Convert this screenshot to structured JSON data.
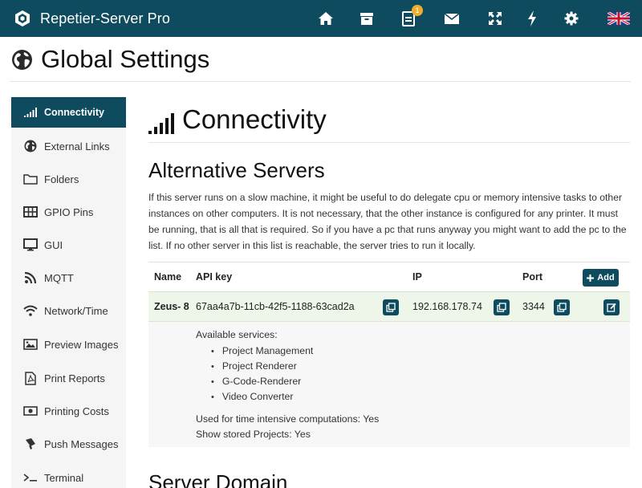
{
  "app": {
    "title": "Repetier-Server Pro"
  },
  "nav": {
    "icons": [
      "home-icon",
      "archive-icon",
      "messages-icon",
      "mail-icon",
      "fullscreen-icon",
      "power-icon",
      "settings-icon",
      "language-flag-icon"
    ],
    "message_badge": "1"
  },
  "page": {
    "title": "Global Settings"
  },
  "sidebar": {
    "items": [
      {
        "label": "Connectivity",
        "icon": "signal-icon"
      },
      {
        "label": "External Links",
        "icon": "globe-icon"
      },
      {
        "label": "Folders",
        "icon": "folder-icon"
      },
      {
        "label": "GPIO Pins",
        "icon": "grid-icon"
      },
      {
        "label": "GUI",
        "icon": "monitor-icon"
      },
      {
        "label": "MQTT",
        "icon": "rss-icon"
      },
      {
        "label": "Network/Time",
        "icon": "wifi-icon"
      },
      {
        "label": "Preview Images",
        "icon": "image-icon"
      },
      {
        "label": "Print Reports",
        "icon": "pdf-icon"
      },
      {
        "label": "Printing Costs",
        "icon": "money-icon"
      },
      {
        "label": "Push Messages",
        "icon": "megaphone-icon"
      },
      {
        "label": "Terminal",
        "icon": "terminal-icon"
      }
    ]
  },
  "main": {
    "section_title": "Connectivity",
    "alt_servers_title": "Alternative Servers",
    "description": "If this server runs on a slow machine, it might be useful to do delegate cpu or memory intensive tasks to other instances on other computers. It is not necessary, that the other instance is configured for any printer. It must be running, that is all that is required. So if you have a pc that runs anyway you might want to add the pc to the list. If no other server in this list is reachable, the server tries to run it locally.",
    "table": {
      "headers": {
        "name": "Name",
        "api_key": "API key",
        "ip": "IP",
        "port": "Port"
      },
      "add_label": "Add",
      "rows": [
        {
          "name": "Zeus- 8",
          "api_key": "67aa4a7b-11cb-42f5-1188-63cad2a",
          "ip": "192.168.178.74",
          "port": "3344"
        }
      ]
    },
    "details": {
      "services_label": "Available services:",
      "services": [
        "Project Management",
        "Project Renderer",
        "G-Code-Renderer",
        "Video Converter"
      ],
      "time_intensive": "Used for time intensive computations: Yes",
      "show_projects": "Show stored Projects: Yes"
    },
    "next_section_title": "Server Domain"
  },
  "colors": {
    "primary": "#0e4b5f",
    "badge": "#f0ad2a",
    "row_highlight": "#eef6e9",
    "sidebar_bg": "#f5f5f5"
  }
}
